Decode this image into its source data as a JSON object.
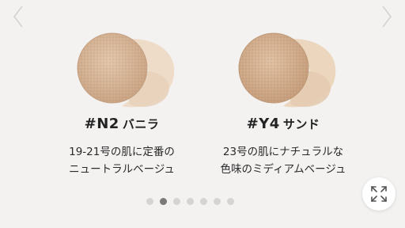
{
  "products": [
    {
      "code": "#N2",
      "name": "バニラ",
      "desc_line1": "19-21号の肌に定番の",
      "desc_line2": "ニュートラルベージュ",
      "puff_color": "#d9b99c",
      "cream_color": "#efdcc8"
    },
    {
      "code": "#Y4",
      "name": "サンド",
      "desc_line1": "23号の肌にナチュラルな",
      "desc_line2": "色味のミディアムベージュ",
      "puff_color": "#d6b596",
      "cream_color": "#ecd6bd"
    }
  ],
  "pagination": {
    "total": 7,
    "current": 2
  },
  "icons": {
    "prev": "chevron-left-icon",
    "next": "chevron-right-icon",
    "expand": "expand-icon"
  }
}
